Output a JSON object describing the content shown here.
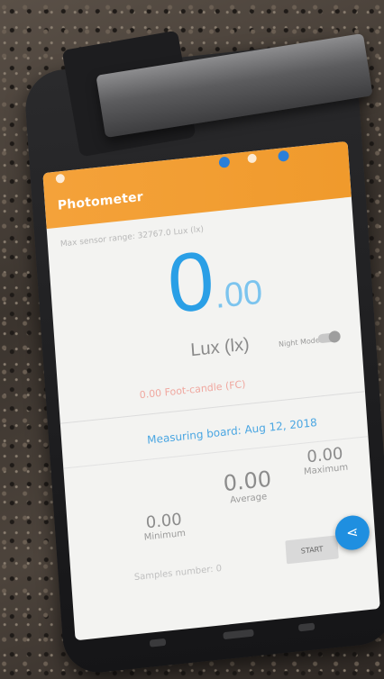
{
  "app": {
    "title": "Photometer",
    "max_range": "Max sensor range: 32767.0 Lux (lx)",
    "lux_int": "0",
    "lux_dec": ".00",
    "unit": "Lux (lx)",
    "night_mode": "Night Mode",
    "foot_candle": "0.00 Foot-candle (FC)",
    "board_label": "Measuring board: Aug 12, 2018",
    "stats": {
      "minimum_value": "0.00",
      "minimum_label": "Minimum",
      "average_value": "0.00",
      "average_label": "Average",
      "maximum_value": "0.00",
      "maximum_label": "Maximum"
    },
    "samples": "Samples number: 0",
    "start_label": "START",
    "share_icon": "share-icon"
  },
  "colors": {
    "appbar": "#f4a23a",
    "accent": "#2a9fe6",
    "fab": "#1f8fe0",
    "foot_candle": "#f0a8a0"
  }
}
